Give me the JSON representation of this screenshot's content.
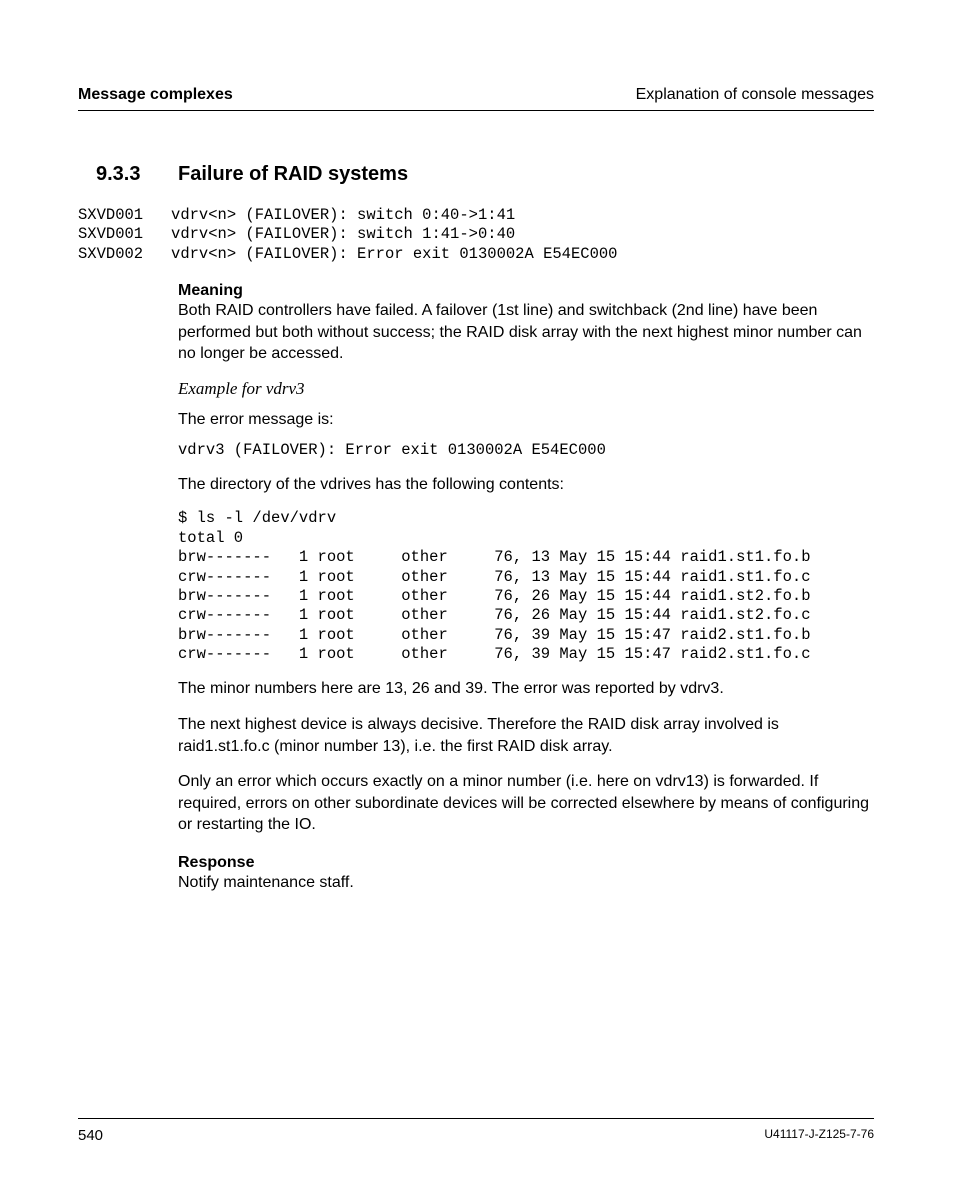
{
  "header": {
    "left": "Message complexes",
    "right": "Explanation of console messages"
  },
  "section": {
    "number": "9.3.3",
    "title": "Failure of RAID systems"
  },
  "msgblock": {
    "l1": "SXVD001   vdrv<n> (FAILOVER): switch 0:40->1:41",
    "l2": "SXVD001   vdrv<n> (FAILOVER): switch 1:41->0:40",
    "l3": "SXVD002   vdrv<n> (FAILOVER): Error exit 0130002A E54EC000"
  },
  "meaning": {
    "heading": "Meaning",
    "text": "Both RAID controllers have failed. A failover (1st line) and switchback (2nd line) have been performed but both without success; the RAID disk array with the next highest minor number can no longer be accessed."
  },
  "example": {
    "heading": "Example for vdrv3",
    "intro": "The error message is:",
    "line": "vdrv3 (FAILOVER): Error exit 0130002A E54EC000",
    "dirintro": "The directory of the vdrives has the following contents:"
  },
  "ls": {
    "cmd": "$ ls -l /dev/vdrv",
    "tot": "total 0",
    "r1": "brw-------   1 root     other     76, 13 May 15 15:44 raid1.st1.fo.b",
    "r2": "crw-------   1 root     other     76, 13 May 15 15:44 raid1.st1.fo.c",
    "r3": "brw-------   1 root     other     76, 26 May 15 15:44 raid1.st2.fo.b",
    "r4": "crw-------   1 root     other     76, 26 May 15 15:44 raid1.st2.fo.c",
    "r5": "brw-------   1 root     other     76, 39 May 15 15:47 raid2.st1.fo.b",
    "r6": "crw-------   1 root     other     76, 39 May 15 15:47 raid2.st1.fo.c"
  },
  "para": {
    "p1": "The minor numbers here are 13, 26 and 39. The error was reported by vdrv3.",
    "p2": "The next highest device is always decisive. Therefore the RAID disk array involved is raid1.st1.fo.c (minor number 13), i.e. the first RAID disk array.",
    "p3": "Only an error which occurs exactly on a minor number (i.e. here on vdrv13) is forwarded. If required, errors on other subordinate devices will be corrected elsewhere by means of configuring or restarting the IO."
  },
  "response": {
    "heading": "Response",
    "text": "Notify maintenance staff."
  },
  "footer": {
    "page": "540",
    "docid": "U41117-J-Z125-7-76"
  }
}
